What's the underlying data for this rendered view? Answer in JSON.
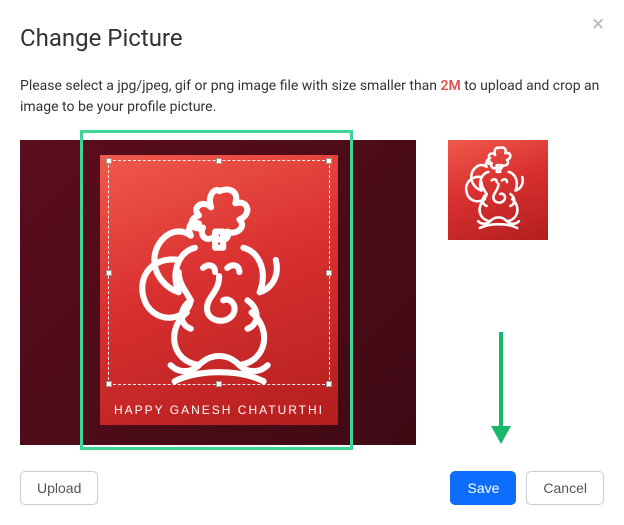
{
  "modal": {
    "title": "Change Picture",
    "close_glyph": "×",
    "instructions_pre": "Please select a jpg/jpeg, gif or png image file with size smaller than ",
    "size_limit": "2M",
    "instructions_post": " to upload and crop an image to be your profile picture."
  },
  "image": {
    "caption": "happy ganesh chaturthi"
  },
  "buttons": {
    "upload": "Upload",
    "save": "Save",
    "cancel": "Cancel"
  },
  "colors": {
    "highlight": "#3dd598",
    "save": "#0d6efd",
    "size_limit": "#d9534f"
  }
}
